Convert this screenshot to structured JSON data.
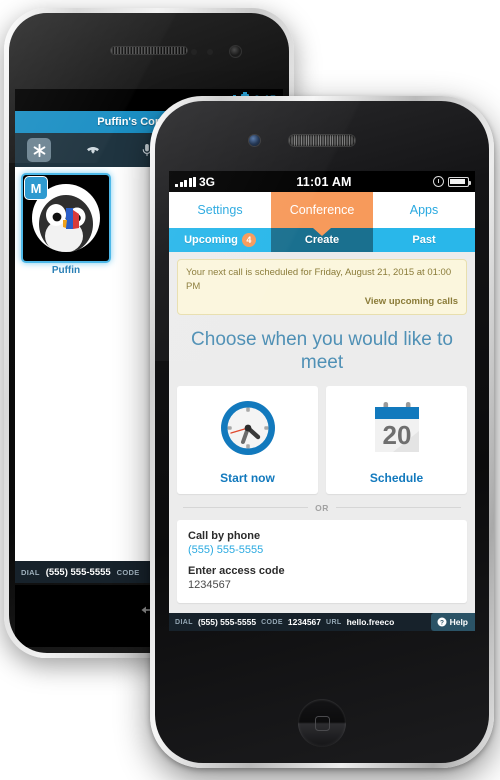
{
  "android": {
    "status": {
      "time": "9:15"
    },
    "title": "Puffin's Conference",
    "toolbar": [
      {
        "name": "asterisk-icon",
        "label": "*"
      },
      {
        "name": "end-call-icon",
        "label": "End call"
      },
      {
        "name": "mic-icon",
        "label": "Mute"
      }
    ],
    "participant": {
      "badge": "M",
      "name": "Puffin"
    },
    "bottombar": {
      "dial_key": "DIAL",
      "dial_value": "(555) 555-5555",
      "code_key": "CODE"
    }
  },
  "iphone": {
    "status": {
      "carrier": "3G",
      "time": "11:01 AM"
    },
    "tabs": [
      {
        "label": "Settings",
        "active": false
      },
      {
        "label": "Conference",
        "active": true
      },
      {
        "label": "Apps",
        "active": false
      }
    ],
    "subtabs": [
      {
        "label": "Upcoming",
        "badge": "4",
        "active": false
      },
      {
        "label": "Create",
        "badge": "",
        "active": true
      },
      {
        "label": "Past",
        "badge": "",
        "active": false
      }
    ],
    "notice": {
      "text": "Your next call is scheduled for Friday, August 21, 2015 at 01:00 PM",
      "link": "View upcoming calls"
    },
    "heading": "Choose when you would like to meet",
    "cards": [
      {
        "icon": "clock-icon",
        "label": "Start now"
      },
      {
        "icon": "calendar-icon",
        "label": "Schedule",
        "day": "20"
      }
    ],
    "divider": "OR",
    "phone_section": {
      "call_label": "Call by phone",
      "phone_number": "(555) 555-5555",
      "code_label": "Enter access code",
      "code_value": "1234567"
    },
    "bottombar": {
      "dial_key": "DIAL",
      "dial_value": "(555) 555-5555",
      "code_key": "CODE",
      "code_value": "1234567",
      "url_key": "URL",
      "url_value": "hello.freeco",
      "help_label": "Help"
    }
  },
  "colors": {
    "accent_blue": "#29a9e0",
    "tab_orange": "#f79a5b",
    "subtab_blue": "#29b7ea",
    "subtab_active": "#1a708f",
    "heading_blue": "#4f90b5",
    "notice_bg": "#fbf6dd",
    "darkbar": "#17222b"
  }
}
